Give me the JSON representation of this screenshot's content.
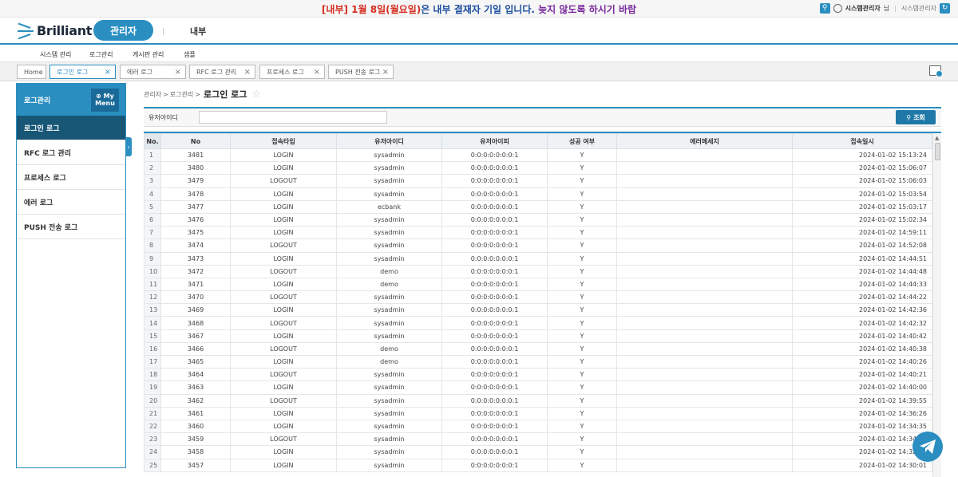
{
  "notice": {
    "part1": "[내부]",
    "part2": "1월 8일(월요일)",
    "part3": "은 내부 결재자 기일 입니다.",
    "part4": "늦지 않도록 하시기 바랍"
  },
  "user": {
    "name": "시스템관리자",
    "suffix": "님",
    "role": "시스템관리자"
  },
  "brand": {
    "name": "Brilliant"
  },
  "header_tabs": {
    "admin": "관리자",
    "internal": "내부"
  },
  "menu": [
    "시스템 관리",
    "로그관리",
    "게시판 관리",
    "샘플"
  ],
  "page_tabs": [
    {
      "label": "Home",
      "closable": false
    },
    {
      "label": "로그인 로그",
      "closable": true,
      "active": true
    },
    {
      "label": "에러 로그",
      "closable": true
    },
    {
      "label": "RFC 로그 관리",
      "closable": true
    },
    {
      "label": "프로세스 로그",
      "closable": true
    },
    {
      "label": "PUSH 전송 로그",
      "closable": true
    }
  ],
  "sidebar": {
    "title": "로그관리",
    "mymenu_line1": "My",
    "mymenu_line2": "Menu",
    "items": [
      "로그인 로그",
      "RFC 로그 관리",
      "프로세스 로그",
      "에러 로그",
      "PUSH 전송 로그"
    ]
  },
  "breadcrumb": {
    "root": "관리자",
    "sep": ">",
    "parent": "로그관리",
    "current": "로그인 로그"
  },
  "search": {
    "label": "유저아이디",
    "value": "",
    "placeholder": "",
    "button": "조회"
  },
  "table": {
    "columns": [
      "No.",
      "No",
      "접속타입",
      "유저아이디",
      "유저아이피",
      "성공 여부",
      "에러메세지",
      "접속일시"
    ],
    "rows": [
      [
        "1",
        "3481",
        "LOGIN",
        "sysadmin",
        "0:0:0:0:0:0:0:1",
        "Y",
        "",
        "2024-01-02 15:13:24"
      ],
      [
        "2",
        "3480",
        "LOGIN",
        "sysadmin",
        "0:0:0:0:0:0:0:1",
        "Y",
        "",
        "2024-01-02 15:06:07"
      ],
      [
        "3",
        "3479",
        "LOGOUT",
        "sysadmin",
        "0:0:0:0:0:0:0:1",
        "Y",
        "",
        "2024-01-02 15:06:03"
      ],
      [
        "4",
        "3478",
        "LOGIN",
        "sysadmin",
        "0:0:0:0:0:0:0:1",
        "Y",
        "",
        "2024-01-02 15:03:54"
      ],
      [
        "5",
        "3477",
        "LOGIN",
        "ecbank",
        "0:0:0:0:0:0:0:1",
        "Y",
        "",
        "2024-01-02 15:03:17"
      ],
      [
        "6",
        "3476",
        "LOGIN",
        "sysadmin",
        "0:0:0:0:0:0:0:1",
        "Y",
        "",
        "2024-01-02 15:02:34"
      ],
      [
        "7",
        "3475",
        "LOGIN",
        "sysadmin",
        "0:0:0:0:0:0:0:1",
        "Y",
        "",
        "2024-01-02 14:59:11"
      ],
      [
        "8",
        "3474",
        "LOGOUT",
        "sysadmin",
        "0:0:0:0:0:0:0:1",
        "Y",
        "",
        "2024-01-02 14:52:08"
      ],
      [
        "9",
        "3473",
        "LOGIN",
        "sysadmin",
        "0:0:0:0:0:0:0:1",
        "Y",
        "",
        "2024-01-02 14:44:51"
      ],
      [
        "10",
        "3472",
        "LOGOUT",
        "demo",
        "0:0:0:0:0:0:0:1",
        "Y",
        "",
        "2024-01-02 14:44:48"
      ],
      [
        "11",
        "3471",
        "LOGIN",
        "demo",
        "0:0:0:0:0:0:0:1",
        "Y",
        "",
        "2024-01-02 14:44:33"
      ],
      [
        "12",
        "3470",
        "LOGOUT",
        "sysadmin",
        "0:0:0:0:0:0:0:1",
        "Y",
        "",
        "2024-01-02 14:44:22"
      ],
      [
        "13",
        "3469",
        "LOGIN",
        "sysadmin",
        "0:0:0:0:0:0:0:1",
        "Y",
        "",
        "2024-01-02 14:42:36"
      ],
      [
        "14",
        "3468",
        "LOGOUT",
        "sysadmin",
        "0:0:0:0:0:0:0:1",
        "Y",
        "",
        "2024-01-02 14:42:32"
      ],
      [
        "15",
        "3467",
        "LOGIN",
        "sysadmin",
        "0:0:0:0:0:0:0:1",
        "Y",
        "",
        "2024-01-02 14:40:42"
      ],
      [
        "16",
        "3466",
        "LOGOUT",
        "demo",
        "0:0:0:0:0:0:0:1",
        "Y",
        "",
        "2024-01-02 14:40:38"
      ],
      [
        "17",
        "3465",
        "LOGIN",
        "demo",
        "0:0:0:0:0:0:0:1",
        "Y",
        "",
        "2024-01-02 14:40:26"
      ],
      [
        "18",
        "3464",
        "LOGOUT",
        "sysadmin",
        "0:0:0:0:0:0:0:1",
        "Y",
        "",
        "2024-01-02 14:40:21"
      ],
      [
        "19",
        "3463",
        "LOGIN",
        "sysadmin",
        "0:0:0:0:0:0:0:1",
        "Y",
        "",
        "2024-01-02 14:40:00"
      ],
      [
        "20",
        "3462",
        "LOGOUT",
        "sysadmin",
        "0:0:0:0:0:0:0:1",
        "Y",
        "",
        "2024-01-02 14:39:55"
      ],
      [
        "21",
        "3461",
        "LOGIN",
        "sysadmin",
        "0:0:0:0:0:0:0:1",
        "Y",
        "",
        "2024-01-02 14:36:26"
      ],
      [
        "22",
        "3460",
        "LOGIN",
        "sysadmin",
        "0:0:0:0:0:0:0:1",
        "Y",
        "",
        "2024-01-02 14:34:35"
      ],
      [
        "23",
        "3459",
        "LOGOUT",
        "sysadmin",
        "0:0:0:0:0:0:0:1",
        "Y",
        "",
        "2024-01-02 14:34:32"
      ],
      [
        "24",
        "3458",
        "LOGIN",
        "sysadmin",
        "0:0:0:0:0:0:0:1",
        "Y",
        "",
        "2024-01-02 14:32:31"
      ],
      [
        "25",
        "3457",
        "LOGIN",
        "sysadmin",
        "0:0:0:0:0:0:0:1",
        "Y",
        "",
        "2024-01-02 14:30:01"
      ]
    ]
  },
  "icons": {
    "search": "search-icon",
    "user": "user-icon",
    "refresh": "refresh-icon",
    "star": "star-icon",
    "screen": "screen-icon",
    "telegram": "paper-plane-icon"
  },
  "colors": {
    "accent": "#2a8ec0",
    "dark_nav": "#185676"
  }
}
